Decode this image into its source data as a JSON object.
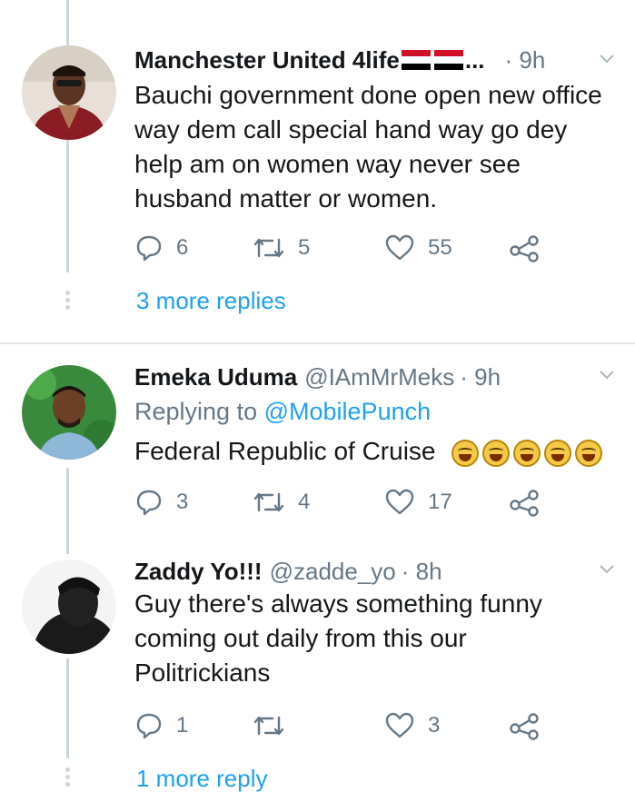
{
  "replies": [
    {
      "name": "Manchester United 4life",
      "name_suffix": "...",
      "time": "· 9h",
      "text": "Bauchi government done open new office way dem call special hand way go dey help am on women way never see husband matter or women.",
      "reply_count": "6",
      "retweet_count": "5",
      "like_count": "55",
      "more_replies": "3 more replies"
    },
    {
      "name": "Emeka Uduma",
      "handle": "@IAmMrMeks",
      "time": "· 9h",
      "replying_prefix": "Replying to",
      "replying_to": "@MobilePunch",
      "text": "Federal Republic of Cruise",
      "emoji_count": 5,
      "reply_count": "3",
      "retweet_count": "4",
      "like_count": "17"
    },
    {
      "name": "Zaddy Yo!!!",
      "handle": "@zadde_yo",
      "time": "· 8h",
      "text": "Guy there's always something funny coming out daily from this our Politrickians",
      "reply_count": "1",
      "retweet_count": "",
      "like_count": "3",
      "more_replies": "1 more reply"
    }
  ],
  "colors": {
    "accent": "#1da1f2",
    "secondary_text": "#657786",
    "thread_line": "#ccd6dd"
  }
}
